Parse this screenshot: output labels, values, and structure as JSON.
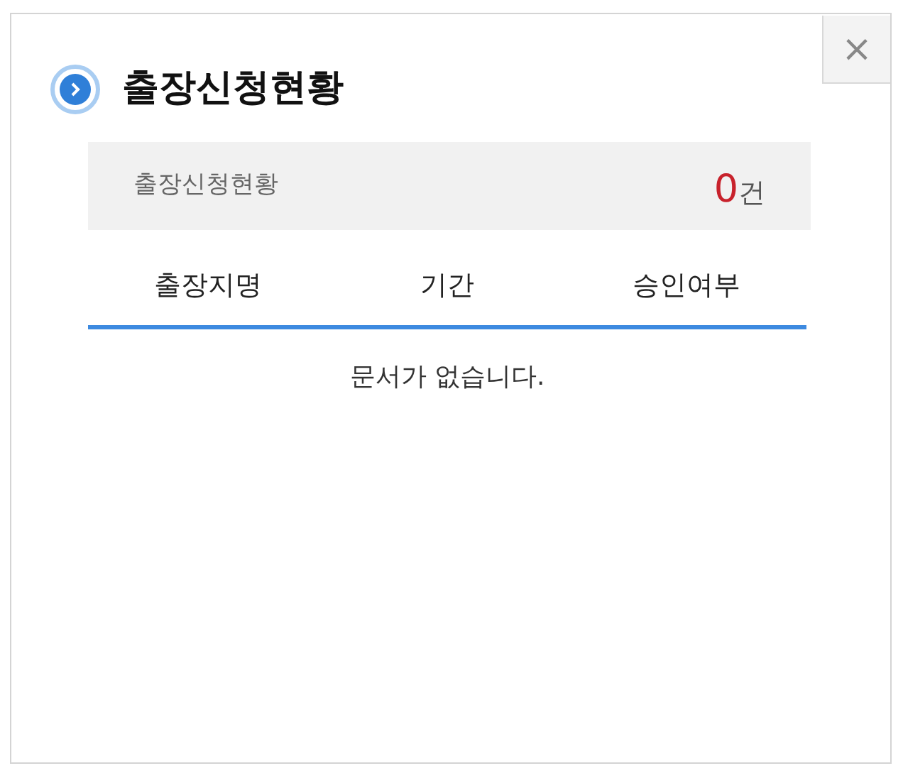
{
  "window": {
    "title": "출장신청현황",
    "close": "×"
  },
  "summary": {
    "label": "출장신청현황",
    "count": "0",
    "unit": "건"
  },
  "table": {
    "columns": [
      "출장지명",
      "기간",
      "승인여부"
    ],
    "empty_message": "문서가 없습니다."
  }
}
